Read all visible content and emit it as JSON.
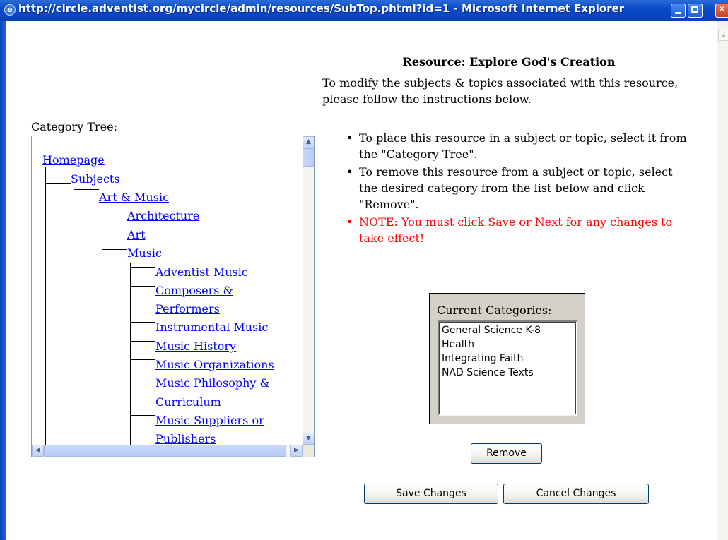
{
  "window": {
    "icon": "ie-icon",
    "title": "http://circle.adventist.org/mycircle/admin/resources/SubTop.phtml?id=1 - Microsoft Internet Explorer"
  },
  "header": {
    "title": "Resource: Explore God's Creation",
    "intro": "To modify the subjects & topics associated with this resource, please follow the instructions below."
  },
  "instructions": [
    "To place this resource in a subject or topic, select it from the \"Category Tree\".",
    "To remove this resource from a subject or topic, select the desired category from the list below and click \"Remove\".",
    "NOTE: You must click Save or Next for any changes to take effect!"
  ],
  "tree": {
    "label": "Category Tree:",
    "nodes": {
      "homepage": "Homepage",
      "subjects": "Subjects",
      "art_music": "Art & Music",
      "architecture": "Architecture",
      "art": "Art",
      "music": "Music",
      "adventist_music": "Adventist Music",
      "composers_1": "Composers &",
      "composers_2": "Performers",
      "instrumental": "Instrumental Music",
      "history": "Music History",
      "organizations": "Music Organizations",
      "philosophy_1": "Music Philosophy &",
      "philosophy_2": "Curriculum",
      "suppliers_1": "Music Suppliers or",
      "suppliers_2": "Publishers"
    }
  },
  "categories": {
    "label": "Current Categories:",
    "items": [
      "General Science K-8",
      "Health",
      "Integrating Faith",
      "NAD Science Texts"
    ]
  },
  "buttons": {
    "remove": "Remove",
    "save": "Save Changes",
    "cancel": "Cancel Changes"
  },
  "colors": {
    "link": "#0000ff",
    "note": "#ff0000",
    "titlebar": "#0a4ac9",
    "panel": "#d4d0c8"
  }
}
